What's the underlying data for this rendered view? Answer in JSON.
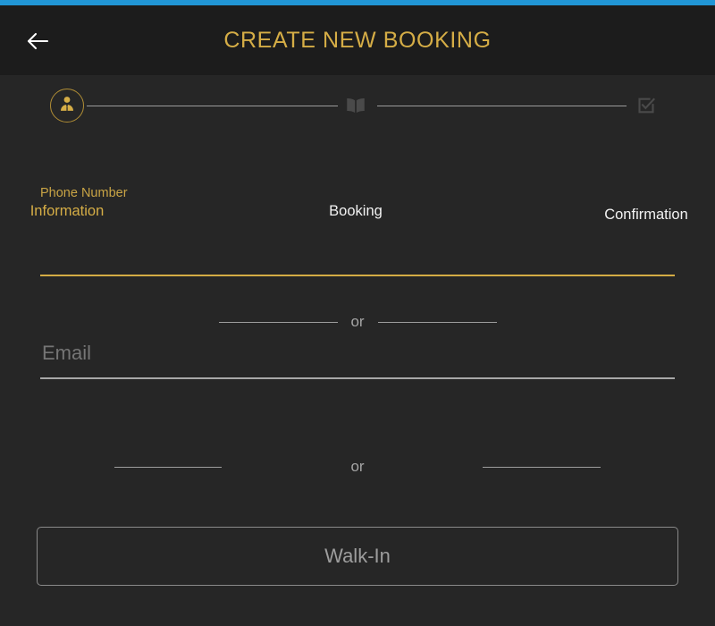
{
  "theme": {
    "accent_gold": "#d5ad46",
    "status_bar_blue": "#2196d6",
    "app_bar_bg": "#1c1c1c",
    "page_bg": "#262626",
    "muted_grey": "#9d9d9d",
    "text_white": "#f2f2f2"
  },
  "app_bar": {
    "title": "CREATE NEW BOOKING",
    "back_icon": "arrow-left-icon"
  },
  "stepper": {
    "steps": [
      {
        "label": "Information",
        "icon": "business-person-icon",
        "state": "active"
      },
      {
        "label": "Booking",
        "icon": "open-book-icon",
        "state": "inactive"
      },
      {
        "label": "Confirmation",
        "icon": "checkbox-checked-icon",
        "state": "inactive"
      }
    ]
  },
  "form": {
    "phone_field": {
      "label": "Phone Number",
      "value": "",
      "placeholder": ""
    },
    "email_field": {
      "label": "Email",
      "value": "",
      "placeholder": "Email"
    },
    "divider_1_text": "or",
    "divider_2_text": "or",
    "walkin_button_label": "Walk-In"
  }
}
